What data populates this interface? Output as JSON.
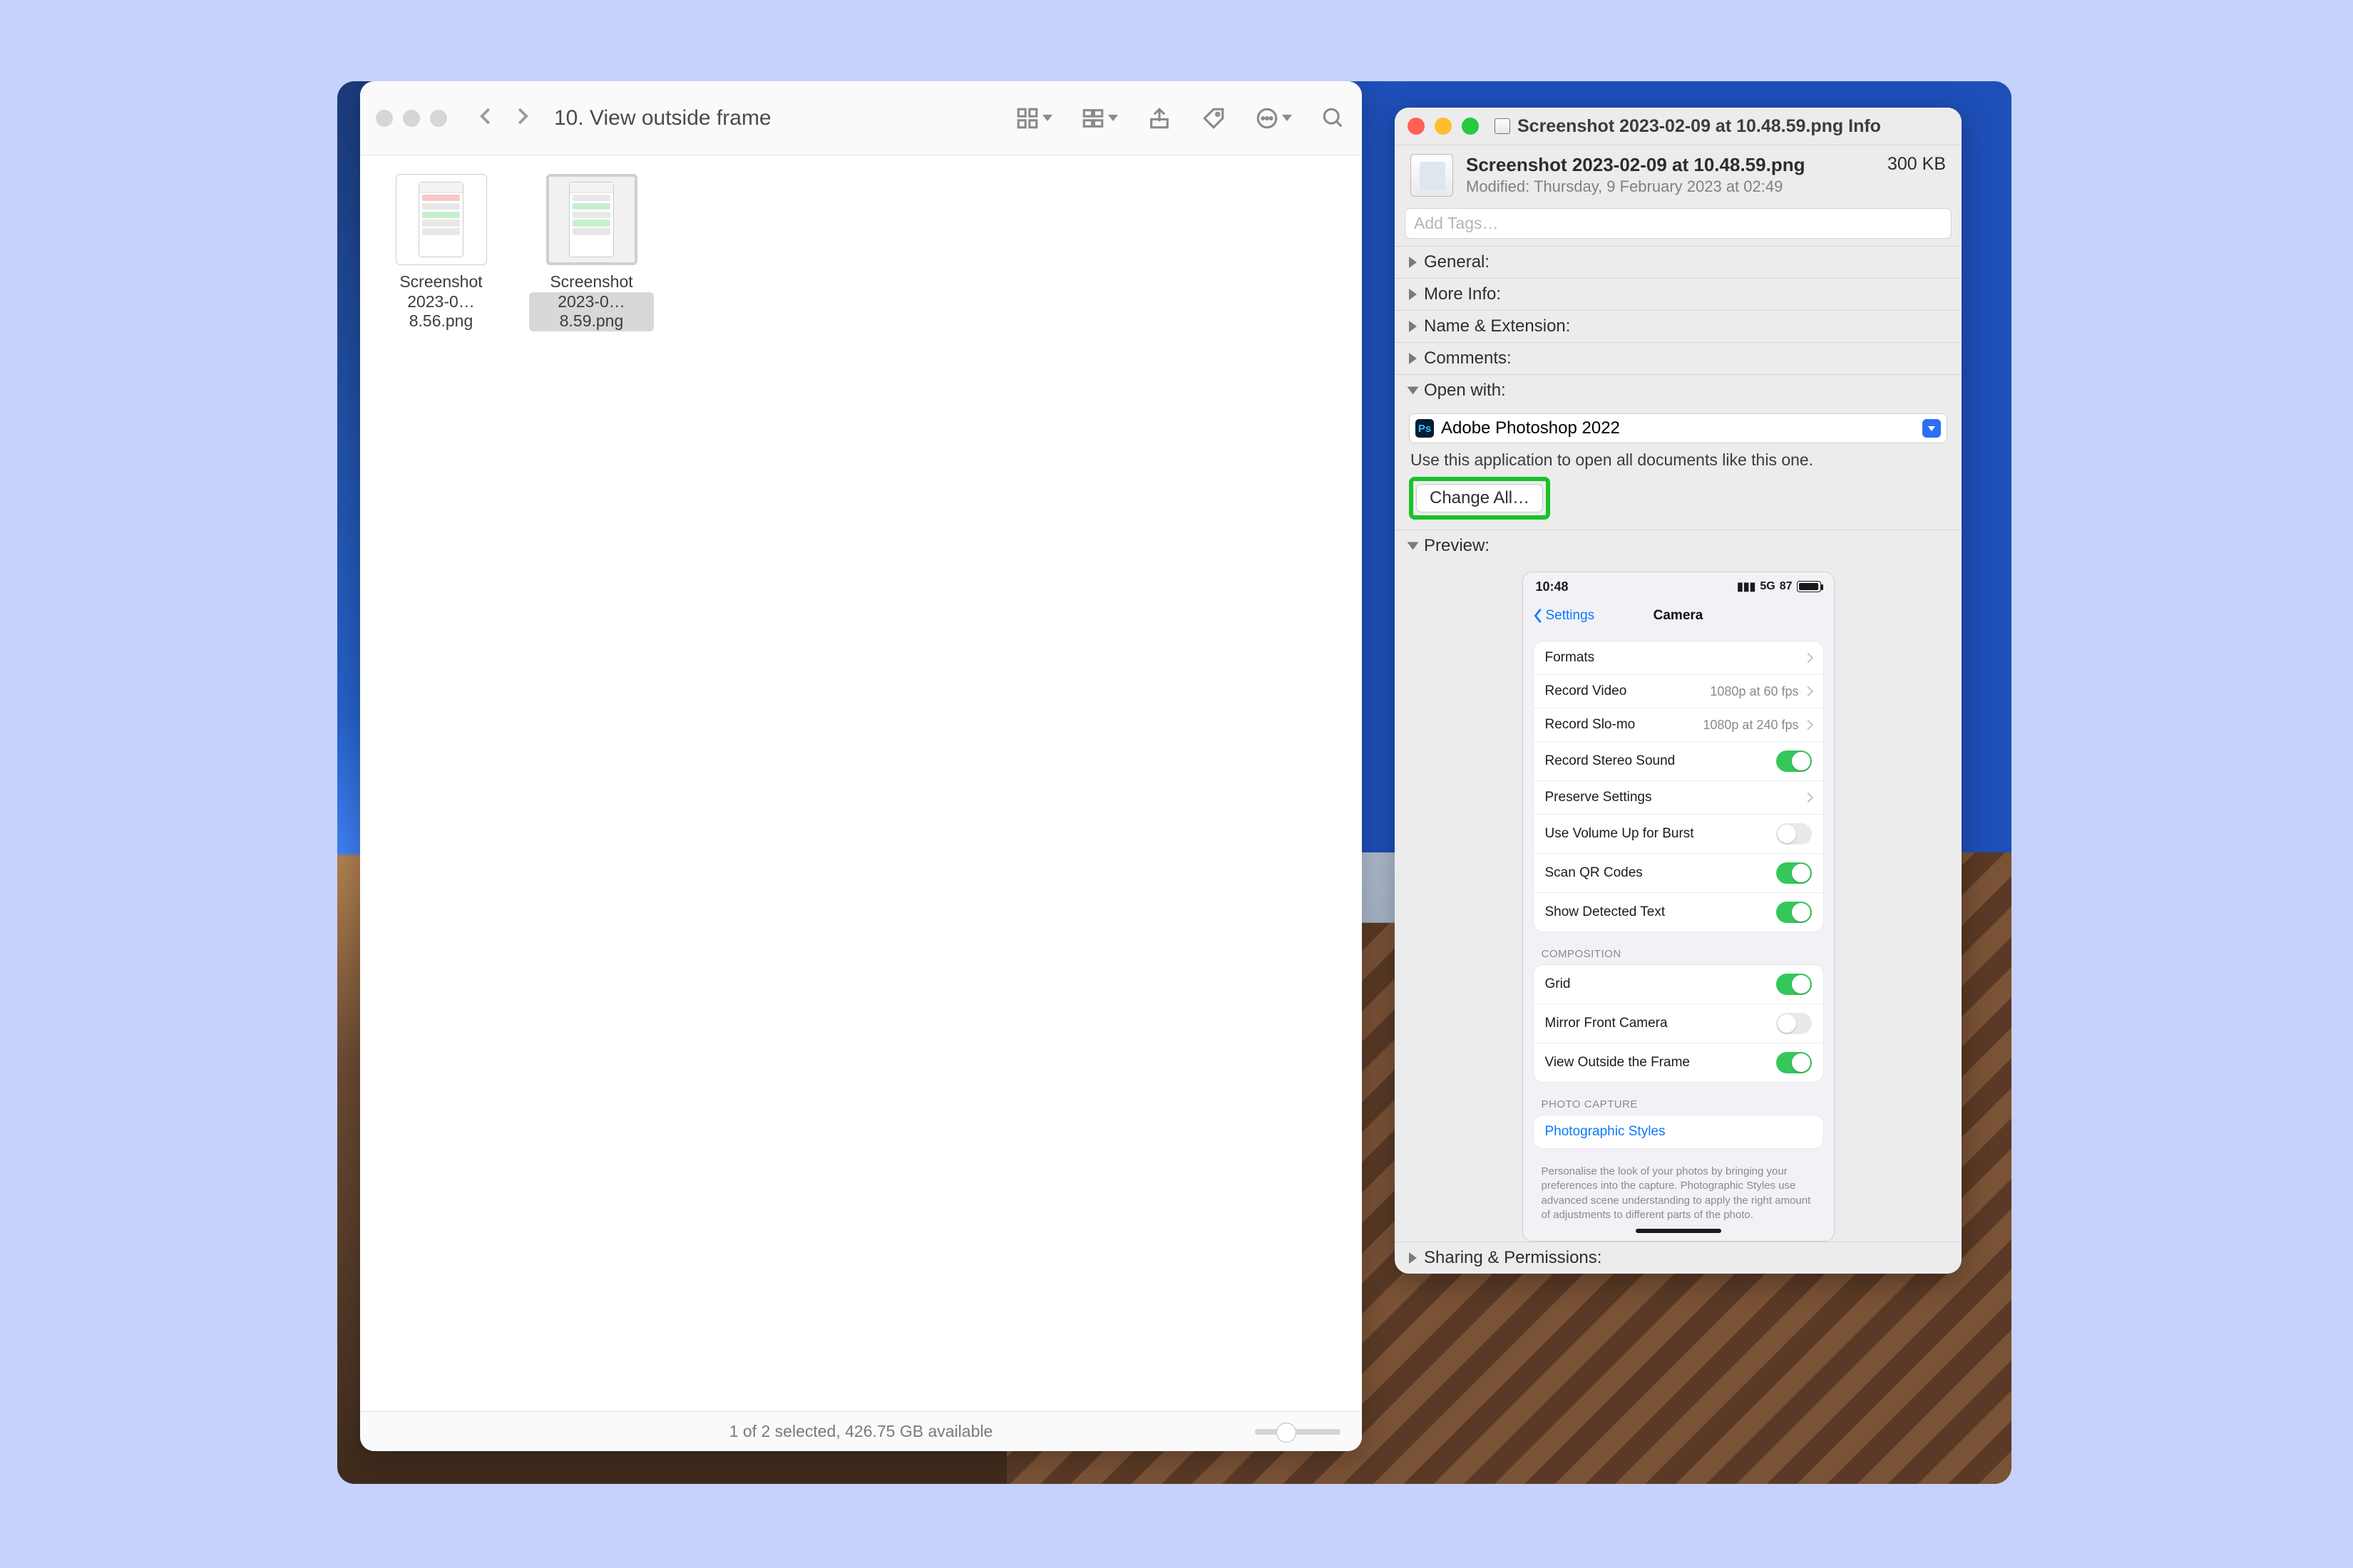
{
  "finder": {
    "path_title": "10. View outside frame",
    "status": "1 of 2 selected, 426.75 GB available",
    "files": [
      {
        "name_l1": "Screenshot",
        "name_l2": "2023-0…8.56.png",
        "selected": false
      },
      {
        "name_l1": "Screenshot",
        "name_l2": "2023-0…8.59.png",
        "selected": true
      }
    ]
  },
  "info": {
    "window_title": "Screenshot 2023-02-09 at 10.48.59.png Info",
    "file_name": "Screenshot 2023-02-09 at 10.48.59.png",
    "file_size": "300 KB",
    "modified": "Modified: Thursday, 9 February 2023 at 02:49",
    "add_tags_placeholder": "Add Tags…",
    "sections": {
      "general": "General:",
      "more_info": "More Info:",
      "name_ext": "Name & Extension:",
      "comments": "Comments:",
      "open_with": "Open with:",
      "preview": "Preview:",
      "sharing": "Sharing & Permissions:"
    },
    "open_with": {
      "app": "Adobe Photoshop 2022",
      "note": "Use this application to open all documents like this one.",
      "change_all": "Change All…"
    }
  },
  "iphone": {
    "time": "10:48",
    "signal": "5G",
    "battery": "87",
    "back_label": "Settings",
    "title": "Camera",
    "rows1": [
      {
        "label": "Formats",
        "kind": "chev"
      },
      {
        "label": "Record Video",
        "value": "1080p at 60 fps",
        "kind": "chev"
      },
      {
        "label": "Record Slo-mo",
        "value": "1080p at 240 fps",
        "kind": "chev"
      },
      {
        "label": "Record Stereo Sound",
        "kind": "toggle",
        "on": true
      },
      {
        "label": "Preserve Settings",
        "kind": "chev"
      },
      {
        "label": "Use Volume Up for Burst",
        "kind": "toggle",
        "on": false
      },
      {
        "label": "Scan QR Codes",
        "kind": "toggle",
        "on": true
      },
      {
        "label": "Show Detected Text",
        "kind": "toggle",
        "on": true
      }
    ],
    "group2_label": "COMPOSITION",
    "rows2": [
      {
        "label": "Grid",
        "kind": "toggle",
        "on": true
      },
      {
        "label": "Mirror Front Camera",
        "kind": "toggle",
        "on": false
      },
      {
        "label": "View Outside the Frame",
        "kind": "toggle",
        "on": true
      }
    ],
    "group3_label": "PHOTO CAPTURE",
    "rows3": [
      {
        "label": "Photographic Styles",
        "kind": "link"
      }
    ],
    "footnote": "Personalise the look of your photos by bringing your preferences into the capture. Photographic Styles use advanced scene understanding to apply the right amount of adjustments to different parts of the photo."
  }
}
